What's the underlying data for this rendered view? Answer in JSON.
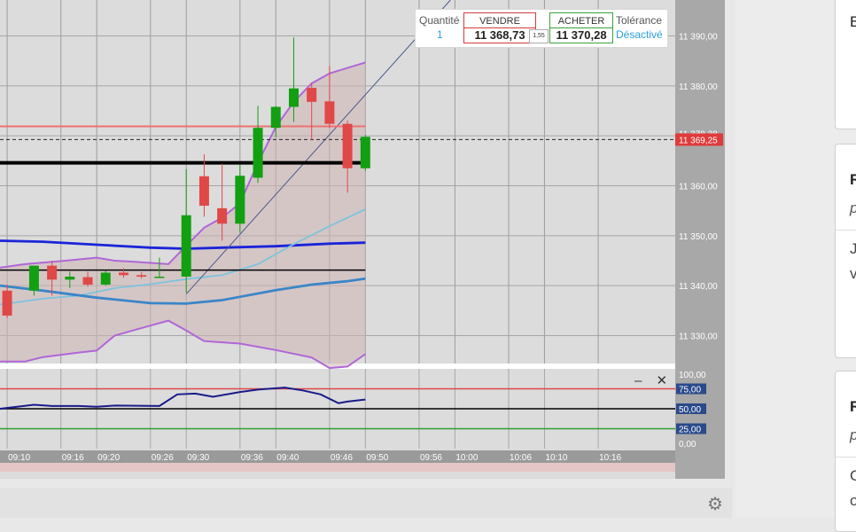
{
  "order_panel": {
    "quantity_label": "Quantité",
    "quantity_value": "1",
    "sell_label": "VENDRE",
    "sell_price": "11 368,73",
    "spread": "1,55",
    "buy_label": "ACHETER",
    "buy_price": "11 370,28",
    "tolerance_label": "Tolérance",
    "tolerance_value": "Désactivé"
  },
  "colors": {
    "bull": "#12a012",
    "bear": "#e04848",
    "bollinger": "#b066d8",
    "ma_fast": "#7cc4dc",
    "ma_mid": "#1a24d8",
    "ma_slow": "#3a86c8",
    "axis_bg": "#a8a8a8"
  },
  "chart_data": [
    {
      "type": "candlestick",
      "y_ticks": [
        "11 390,00",
        "11 380,00",
        "11 370,00",
        "11 360,00",
        "11 350,00",
        "11 340,00",
        "11 330,00"
      ],
      "y_tick_values": [
        11390,
        11380,
        11370,
        11360,
        11350,
        11340,
        11330
      ],
      "ylim": [
        11324.4,
        11397.2
      ],
      "x_ticks": [
        "09:10",
        "09:16",
        "09:20",
        "09:26",
        "09:30",
        "09:36",
        "09:40",
        "09:46",
        "09:50",
        "09:56",
        "10:00",
        "10:06",
        "10:10",
        "10:16"
      ],
      "x_tick_values": [
        10,
        16,
        20,
        26,
        30,
        36,
        40,
        46,
        50,
        56,
        60,
        66,
        70,
        76
      ],
      "x_unit": "minutes after 09:00",
      "xlim": [
        9.2,
        84.6
      ],
      "current_price_label": "11 369,25",
      "current_price": 11369.25,
      "hidden_price_label": "11 370,28",
      "candles": [
        {
          "t": 10,
          "o": 11339,
          "h": 11340.2,
          "c": 11334,
          "l": 11333.5
        },
        {
          "t": 13,
          "o": 11339,
          "h": 11344,
          "c": 11344,
          "l": 11338
        },
        {
          "t": 15,
          "o": 11344,
          "h": 11345,
          "c": 11341.2,
          "l": 11338
        },
        {
          "t": 17,
          "o": 11341.2,
          "h": 11342.8,
          "c": 11341.8,
          "l": 11339.5
        },
        {
          "t": 19,
          "o": 11341.7,
          "h": 11342.8,
          "c": 11340.2,
          "l": 11339.8
        },
        {
          "t": 21,
          "o": 11340.2,
          "h": 11343,
          "c": 11342.6,
          "l": 11340
        },
        {
          "t": 23,
          "o": 11342.6,
          "h": 11343.5,
          "c": 11342.1,
          "l": 11341.6
        },
        {
          "t": 25,
          "o": 11342.1,
          "h": 11342.7,
          "c": 11341.8,
          "l": 11341.4
        },
        {
          "t": 27,
          "o": 11341.8,
          "h": 11345.6,
          "c": 11341.8,
          "l": 11341.6
        },
        {
          "t": 30,
          "o": 11341.8,
          "h": 11363.3,
          "c": 11354.1,
          "l": 11338.6
        },
        {
          "t": 32,
          "o": 11361.9,
          "h": 11366.3,
          "c": 11356,
          "l": 11353.8
        },
        {
          "t": 34,
          "o": 11355.5,
          "h": 11364.4,
          "c": 11352.4,
          "l": 11349
        },
        {
          "t": 36,
          "o": 11352.4,
          "h": 11364.2,
          "c": 11362,
          "l": 11350.6
        },
        {
          "t": 38,
          "o": 11361.6,
          "h": 11376,
          "c": 11371.6,
          "l": 11360.6
        },
        {
          "t": 40,
          "o": 11371.6,
          "h": 11376,
          "c": 11375.8,
          "l": 11369.7
        },
        {
          "t": 42,
          "o": 11375.8,
          "h": 11389.7,
          "c": 11379.5,
          "l": 11372.8
        },
        {
          "t": 44,
          "o": 11379.6,
          "h": 11380.6,
          "c": 11376.8,
          "l": 11369.1
        },
        {
          "t": 46,
          "o": 11376.9,
          "h": 11384,
          "c": 11372.4,
          "l": 11371.6
        },
        {
          "t": 48,
          "o": 11372.4,
          "h": 11373.1,
          "c": 11363.5,
          "l": 11358.6
        },
        {
          "t": 50,
          "o": 11363.5,
          "h": 11370.2,
          "c": 11369.8,
          "l": 11363
        }
      ],
      "bollinger_upper": [
        [
          9.2,
          11343.6
        ],
        [
          12,
          11344.3
        ],
        [
          16,
          11344.9
        ],
        [
          20,
          11345.6
        ],
        [
          22,
          11345
        ],
        [
          24,
          11344.8
        ],
        [
          28,
          11344.3
        ],
        [
          30,
          11348
        ],
        [
          32,
          11351.6
        ],
        [
          34,
          11353.6
        ],
        [
          36,
          11356.5
        ],
        [
          38,
          11364.6
        ],
        [
          40,
          11371.8
        ],
        [
          42,
          11376.8
        ],
        [
          44,
          11380.5
        ],
        [
          46,
          11382.5
        ],
        [
          50,
          11384.7
        ]
      ],
      "bollinger_lower": [
        [
          9.2,
          11324.8
        ],
        [
          12,
          11324.8
        ],
        [
          14,
          11325.7
        ],
        [
          18,
          11326.6
        ],
        [
          20,
          11327
        ],
        [
          22,
          11330
        ],
        [
          24,
          11331
        ],
        [
          26,
          11332
        ],
        [
          28,
          11333
        ],
        [
          30,
          11331
        ],
        [
          32,
          11328.9
        ],
        [
          36,
          11328.4
        ],
        [
          40,
          11327.1
        ],
        [
          44,
          11325.6
        ],
        [
          46,
          11323.5
        ],
        [
          48,
          11323.8
        ],
        [
          50,
          11326.3
        ]
      ],
      "horizontal_lines": [
        {
          "level": 11371.9,
          "color": "#f07070",
          "width": 2
        },
        {
          "level": 11369.25,
          "color": "#222222",
          "width": 1,
          "dashed": true
        },
        {
          "level": 11364.6,
          "color": "#000000",
          "width": 4
        },
        {
          "level": 11343.1,
          "color": "#000000",
          "width": 1.5
        }
      ],
      "moving_averages": [
        {
          "color": "#1a24d8",
          "width": 2.8,
          "points": [
            [
              9.2,
              11349
            ],
            [
              14,
              11348.8
            ],
            [
              20,
              11348.2
            ],
            [
              26,
              11347.6
            ],
            [
              30,
              11347.4
            ],
            [
              34,
              11347.6
            ],
            [
              40,
              11347.9
            ],
            [
              46,
              11348.4
            ],
            [
              50,
              11348.6
            ]
          ]
        },
        {
          "color": "#7cc4dc",
          "width": 1.8,
          "points": [
            [
              9.2,
              11336.2
            ],
            [
              14,
              11337.4
            ],
            [
              18,
              11338
            ],
            [
              22,
              11339.5
            ],
            [
              26,
              11340.3
            ],
            [
              30,
              11341.3
            ],
            [
              34,
              11342.1
            ],
            [
              38,
              11344.3
            ],
            [
              42,
              11348.3
            ],
            [
              46,
              11351.9
            ],
            [
              50,
              11355.3
            ]
          ]
        },
        {
          "color": "#3a86c8",
          "width": 2.8,
          "points": [
            [
              9.2,
              11340
            ],
            [
              14,
              11339
            ],
            [
              20,
              11337.6
            ],
            [
              26,
              11336.5
            ],
            [
              30,
              11336.4
            ],
            [
              34,
              11337.1
            ],
            [
              40,
              11339.1
            ],
            [
              44,
              11340.2
            ],
            [
              48,
              11340.9
            ],
            [
              50,
              11341.4
            ]
          ]
        }
      ],
      "trend_lines": [
        {
          "from": [
            30,
            11338.3
          ],
          "to": [
            59.5,
            11397.2
          ]
        }
      ]
    },
    {
      "type": "line",
      "y_ticks": [
        "100,00",
        "75,00",
        "50,00",
        "25,00",
        "0,00"
      ],
      "y_tick_values": [
        100,
        75,
        50,
        25,
        0
      ],
      "ylim": [
        0,
        100
      ],
      "reference_lines": [
        {
          "level": 75,
          "color": "#e04848"
        },
        {
          "level": 50,
          "color": "#000000"
        },
        {
          "level": 25,
          "color": "#30a030"
        }
      ],
      "series": [
        {
          "color": "#1a1a8a",
          "points": [
            [
              9.2,
              50
            ],
            [
              13,
              55
            ],
            [
              15,
              53.5
            ],
            [
              18,
              53.5
            ],
            [
              20,
              52.5
            ],
            [
              22,
              54
            ],
            [
              27,
              53.5
            ],
            [
              29,
              68
            ],
            [
              31,
              69
            ],
            [
              33,
              65
            ],
            [
              36,
              71
            ],
            [
              38,
              74
            ],
            [
              41,
              76.5
            ],
            [
              43,
              73
            ],
            [
              45,
              68
            ],
            [
              47,
              57
            ],
            [
              48,
              59
            ],
            [
              50,
              61.5
            ]
          ]
        }
      ]
    }
  ],
  "oscillator": {
    "minimize_symbol": "–",
    "close_symbol": "✕"
  },
  "right_panel": {
    "cards": [
      {
        "text": "B"
      },
      {
        "text": "R",
        "sub1": "p",
        "sub2": "J",
        "sub3": "v"
      },
      {
        "text": "R",
        "sub1": "p",
        "sub2": "C",
        "sub3": "o"
      }
    ]
  }
}
